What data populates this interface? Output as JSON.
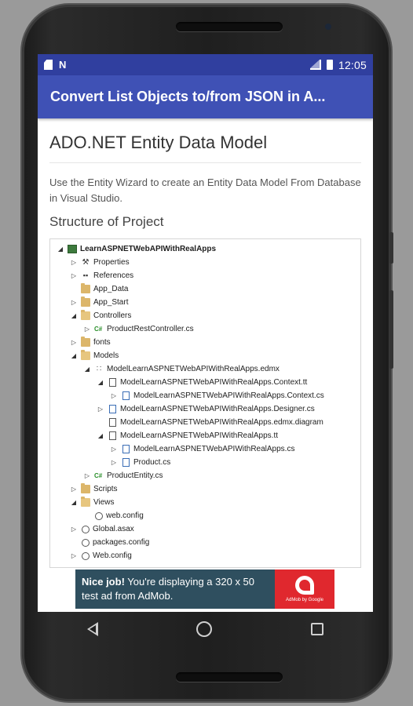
{
  "status_bar": {
    "time": "12:05",
    "left_icons": [
      "sd-card-icon",
      "n-icon"
    ],
    "right_icons": [
      "signal-icon",
      "battery-icon"
    ]
  },
  "appbar": {
    "title": "Convert List Objects to/from JSON in A..."
  },
  "article": {
    "heading": "ADO.NET Entity Data Model",
    "paragraph": "Use the Entity Wizard to create an Entity Data Model From Database in Visual Studio.",
    "subheading": "Structure of Project"
  },
  "tree": {
    "items": [
      {
        "label": "LearnASPNETWebAPIWithRealApps",
        "level": 0,
        "toggle": "expanded",
        "icon": "project-icon",
        "bold": true
      },
      {
        "label": "Properties",
        "level": 1,
        "toggle": "collapsed",
        "icon": "wrench-icon"
      },
      {
        "label": "References",
        "level": 1,
        "toggle": "collapsed",
        "icon": "references-icon"
      },
      {
        "label": "App_Data",
        "level": 1,
        "toggle": "none",
        "icon": "folder-icon"
      },
      {
        "label": "App_Start",
        "level": 1,
        "toggle": "collapsed",
        "icon": "folder-icon"
      },
      {
        "label": "Controllers",
        "level": 1,
        "toggle": "expanded",
        "icon": "folder-open-icon"
      },
      {
        "label": "ProductRestController.cs",
        "level": 2,
        "toggle": "collapsed",
        "icon": "csharp-icon"
      },
      {
        "label": "fonts",
        "level": 1,
        "toggle": "collapsed",
        "icon": "folder-icon"
      },
      {
        "label": "Models",
        "level": 1,
        "toggle": "expanded",
        "icon": "folder-open-icon"
      },
      {
        "label": "ModelLearnASPNETWebAPIWithRealApps.edmx",
        "level": 2,
        "toggle": "expanded",
        "icon": "edmx-icon"
      },
      {
        "label": "ModelLearnASPNETWebAPIWithRealApps.Context.tt",
        "level": 3,
        "toggle": "expanded",
        "icon": "file-icon"
      },
      {
        "label": "ModelLearnASPNETWebAPIWithRealApps.Context.cs",
        "level": 4,
        "toggle": "collapsed",
        "icon": "file-blue-icon"
      },
      {
        "label": "ModelLearnASPNETWebAPIWithRealApps.Designer.cs",
        "level": 3,
        "toggle": "collapsed",
        "icon": "file-blue-icon"
      },
      {
        "label": "ModelLearnASPNETWebAPIWithRealApps.edmx.diagram",
        "level": 3,
        "toggle": "none",
        "icon": "file-icon"
      },
      {
        "label": "ModelLearnASPNETWebAPIWithRealApps.tt",
        "level": 3,
        "toggle": "expanded",
        "icon": "file-icon"
      },
      {
        "label": "ModelLearnASPNETWebAPIWithRealApps.cs",
        "level": 4,
        "toggle": "collapsed",
        "icon": "file-blue-icon"
      },
      {
        "label": "Product.cs",
        "level": 4,
        "toggle": "collapsed",
        "icon": "file-blue-icon"
      },
      {
        "label": "ProductEntity.cs",
        "level": 2,
        "toggle": "collapsed",
        "icon": "csharp-icon"
      },
      {
        "label": "Scripts",
        "level": 1,
        "toggle": "collapsed",
        "icon": "folder-icon"
      },
      {
        "label": "Views",
        "level": 1,
        "toggle": "expanded",
        "icon": "folder-open-icon"
      },
      {
        "label": "web.config",
        "level": 2,
        "toggle": "none",
        "icon": "config-icon"
      },
      {
        "label": "Global.asax",
        "level": 1,
        "toggle": "collapsed",
        "icon": "config-icon"
      },
      {
        "label": "packages.config",
        "level": 1,
        "toggle": "none",
        "icon": "config-icon"
      },
      {
        "label": "Web.config",
        "level": 1,
        "toggle": "collapsed",
        "icon": "config-icon"
      }
    ]
  },
  "ad": {
    "bold": "Nice job!",
    "text": " You're displaying a 320 x 50 test ad from AdMob.",
    "logo_caption": "AdMob by Google"
  },
  "colors": {
    "status_bar": "#303f9f",
    "app_bar": "#3f51b5",
    "ad_background": "#2f4f5f",
    "ad_logo": "#e0282e"
  }
}
